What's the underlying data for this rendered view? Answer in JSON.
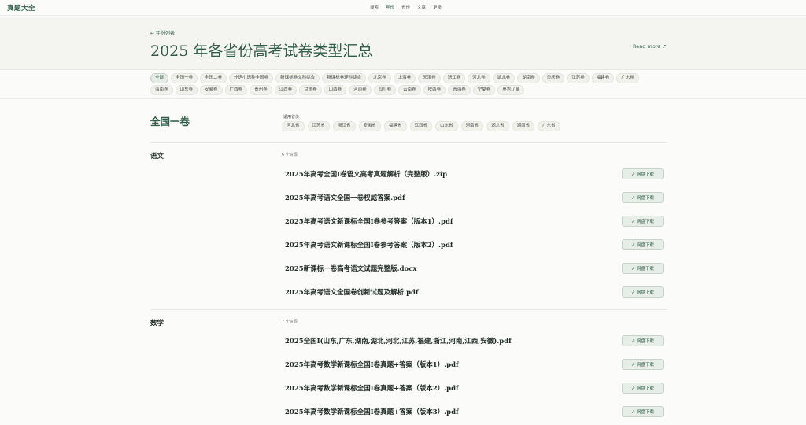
{
  "brand": "真题大全",
  "nav": [
    "搜索",
    "年份",
    "省份",
    "文章",
    "更多"
  ],
  "nav_active": 1,
  "back_link": "← 年份列表",
  "page_title": "2025 年各省份高考试卷类型汇总",
  "read_more": "Read more ↗",
  "chips_row1": [
    "全部",
    "全国一卷",
    "全国二卷",
    "外语小语种全国卷",
    "新课标卷文科综合",
    "新课标卷理科综合",
    "北京卷",
    "上海卷",
    "天津卷",
    "浙江卷",
    "河北卷",
    "湖北卷",
    "湖南卷",
    "重庆卷",
    "江苏卷",
    "福建卷",
    "广东卷"
  ],
  "chips_row2": [
    "海南卷",
    "山东卷",
    "安徽卷",
    "广西卷",
    "贵州卷",
    "江西卷",
    "甘肃卷",
    "山西卷",
    "河南卷",
    "四川卷",
    "云南卷",
    "陕西卷",
    "青海卷",
    "宁夏卷",
    "黑吉辽蒙"
  ],
  "section": {
    "name": "全国一卷",
    "applies_label": "适用省份",
    "provinces": [
      "河北省",
      "江苏省",
      "浙江省",
      "安徽省",
      "福建省",
      "江西省",
      "山东省",
      "河南省",
      "湖北省",
      "湖南省",
      "广东省"
    ]
  },
  "download_label": "网盘下载",
  "download_icon": "external-link-icon",
  "subjects": [
    {
      "name": "语文",
      "count": "6 个资源",
      "files": [
        "2025年高考全国Ⅰ卷语文高考真题解析（完整版）.zip",
        "2025年高考语文全国一卷权威答案.pdf",
        "2025年高考语文新课标全国Ⅰ卷参考答案（版本1）.pdf",
        "2025年高考语文新课标全国Ⅰ卷参考答案（版本2）.pdf",
        "2025新课标一卷高考语文试题完整版.docx",
        "2025年高考语文全国卷创新试题及解析.pdf"
      ]
    },
    {
      "name": "数学",
      "count": "7 个资源",
      "files": [
        "2025全国Ⅰ(山东,广东,湖南,湖北,河北,江苏,福建,浙江,河南,江西,安徽).pdf",
        "2025年高考数学新课标全国Ⅰ卷真题+答案（版本1）.pdf",
        "2025年高考数学新课标全国Ⅰ卷真题+答案（版本2）.pdf",
        "2025年高考数学新课标全国Ⅰ卷真题+答案（版本3）.pdf"
      ]
    }
  ]
}
